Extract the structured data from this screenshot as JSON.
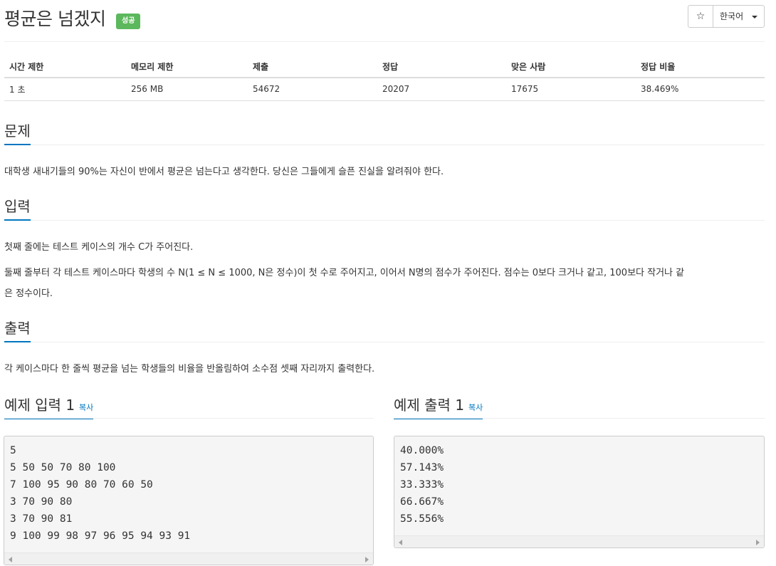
{
  "problem": {
    "title": "평균은 넘겠지",
    "status_badge": "성공",
    "favorite_icon": "☆",
    "language": "한국어"
  },
  "info_table": {
    "headers": [
      "시간 제한",
      "메모리 제한",
      "제출",
      "정답",
      "맞은 사람",
      "정답 비율"
    ],
    "values": [
      "1 초",
      "256 MB",
      "54672",
      "20207",
      "17675",
      "38.469%"
    ]
  },
  "sections": {
    "description": {
      "title": "문제",
      "text": "대학생 새내기들의 90%는 자신이 반에서 평균은 넘는다고 생각한다. 당신은 그들에게 슬픈 진실을 알려줘야 한다."
    },
    "input": {
      "title": "입력",
      "line1": "첫째 줄에는 테스트 케이스의 개수 C가 주어진다.",
      "line2": "둘째 줄부터 각 테스트 케이스마다 학생의 수 N(1 ≤ N ≤ 1000, N은 정수)이 첫 수로 주어지고, 이어서 N명의 점수가 주어진다. 점수는 0보다 크거나 같고, 100보다 작거나 같",
      "line3": "은 정수이다."
    },
    "output": {
      "title": "출력",
      "text": "각 케이스마다 한 줄씩 평균을 넘는 학생들의 비율을 반올림하여 소수점 셋째 자리까지 출력한다."
    }
  },
  "samples": {
    "input": {
      "title": "예제 입력 1",
      "copy_label": "복사",
      "lines": [
        "5",
        "5 50 50 70 80 100",
        "7 100 95 90 80 70 60 50",
        "3 70 90 80",
        "3 70 90 81",
        "9 100 99 98 97 96 95 94 93 91"
      ]
    },
    "output": {
      "title": "예제 출력 1",
      "copy_label": "복사",
      "lines": [
        "40.000%",
        "57.143%",
        "33.333%",
        "66.667%",
        "55.556%"
      ]
    }
  },
  "colors": {
    "accent": "#0076c0",
    "success": "#5cb85c",
    "pre_background": "#f5f5f5"
  }
}
